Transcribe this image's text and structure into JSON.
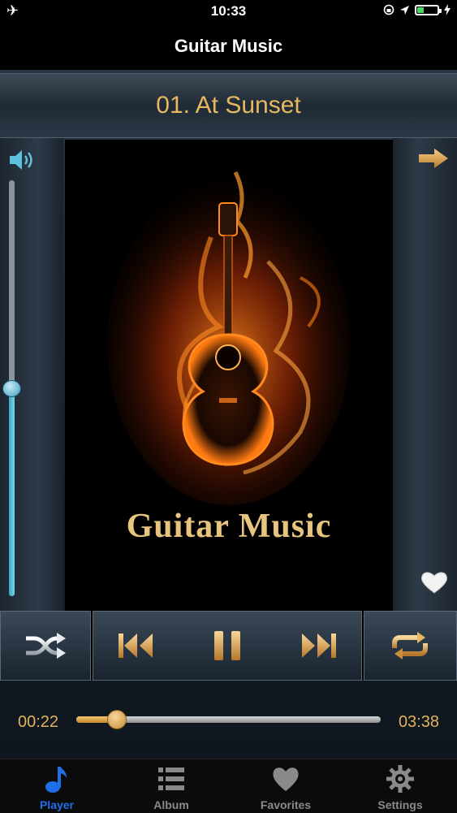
{
  "status": {
    "time": "10:33",
    "battery_level": 0.3
  },
  "nav": {
    "title": "Guitar Music"
  },
  "player": {
    "song_title": "01. At Sunset",
    "album_art_title": "Guitar Music",
    "volume_level": 0.5,
    "current_time": "00:22",
    "total_time": "03:38",
    "progress_fraction": 0.13
  },
  "colors": {
    "accent_gold": "#e3b25a",
    "active_tab": "#1f6fe8",
    "volume_blue": "#39a9c9"
  },
  "controls": [
    "shuffle-icon",
    "previous-icon",
    "pause-icon",
    "next-icon",
    "repeat-icon"
  ],
  "tabs": [
    {
      "label": "Player",
      "icon": "music-note-icon",
      "active": true
    },
    {
      "label": "Album",
      "icon": "list-icon",
      "active": false
    },
    {
      "label": "Favorites",
      "icon": "heart-icon",
      "active": false
    },
    {
      "label": "Settings",
      "icon": "gear-icon",
      "active": false
    }
  ]
}
